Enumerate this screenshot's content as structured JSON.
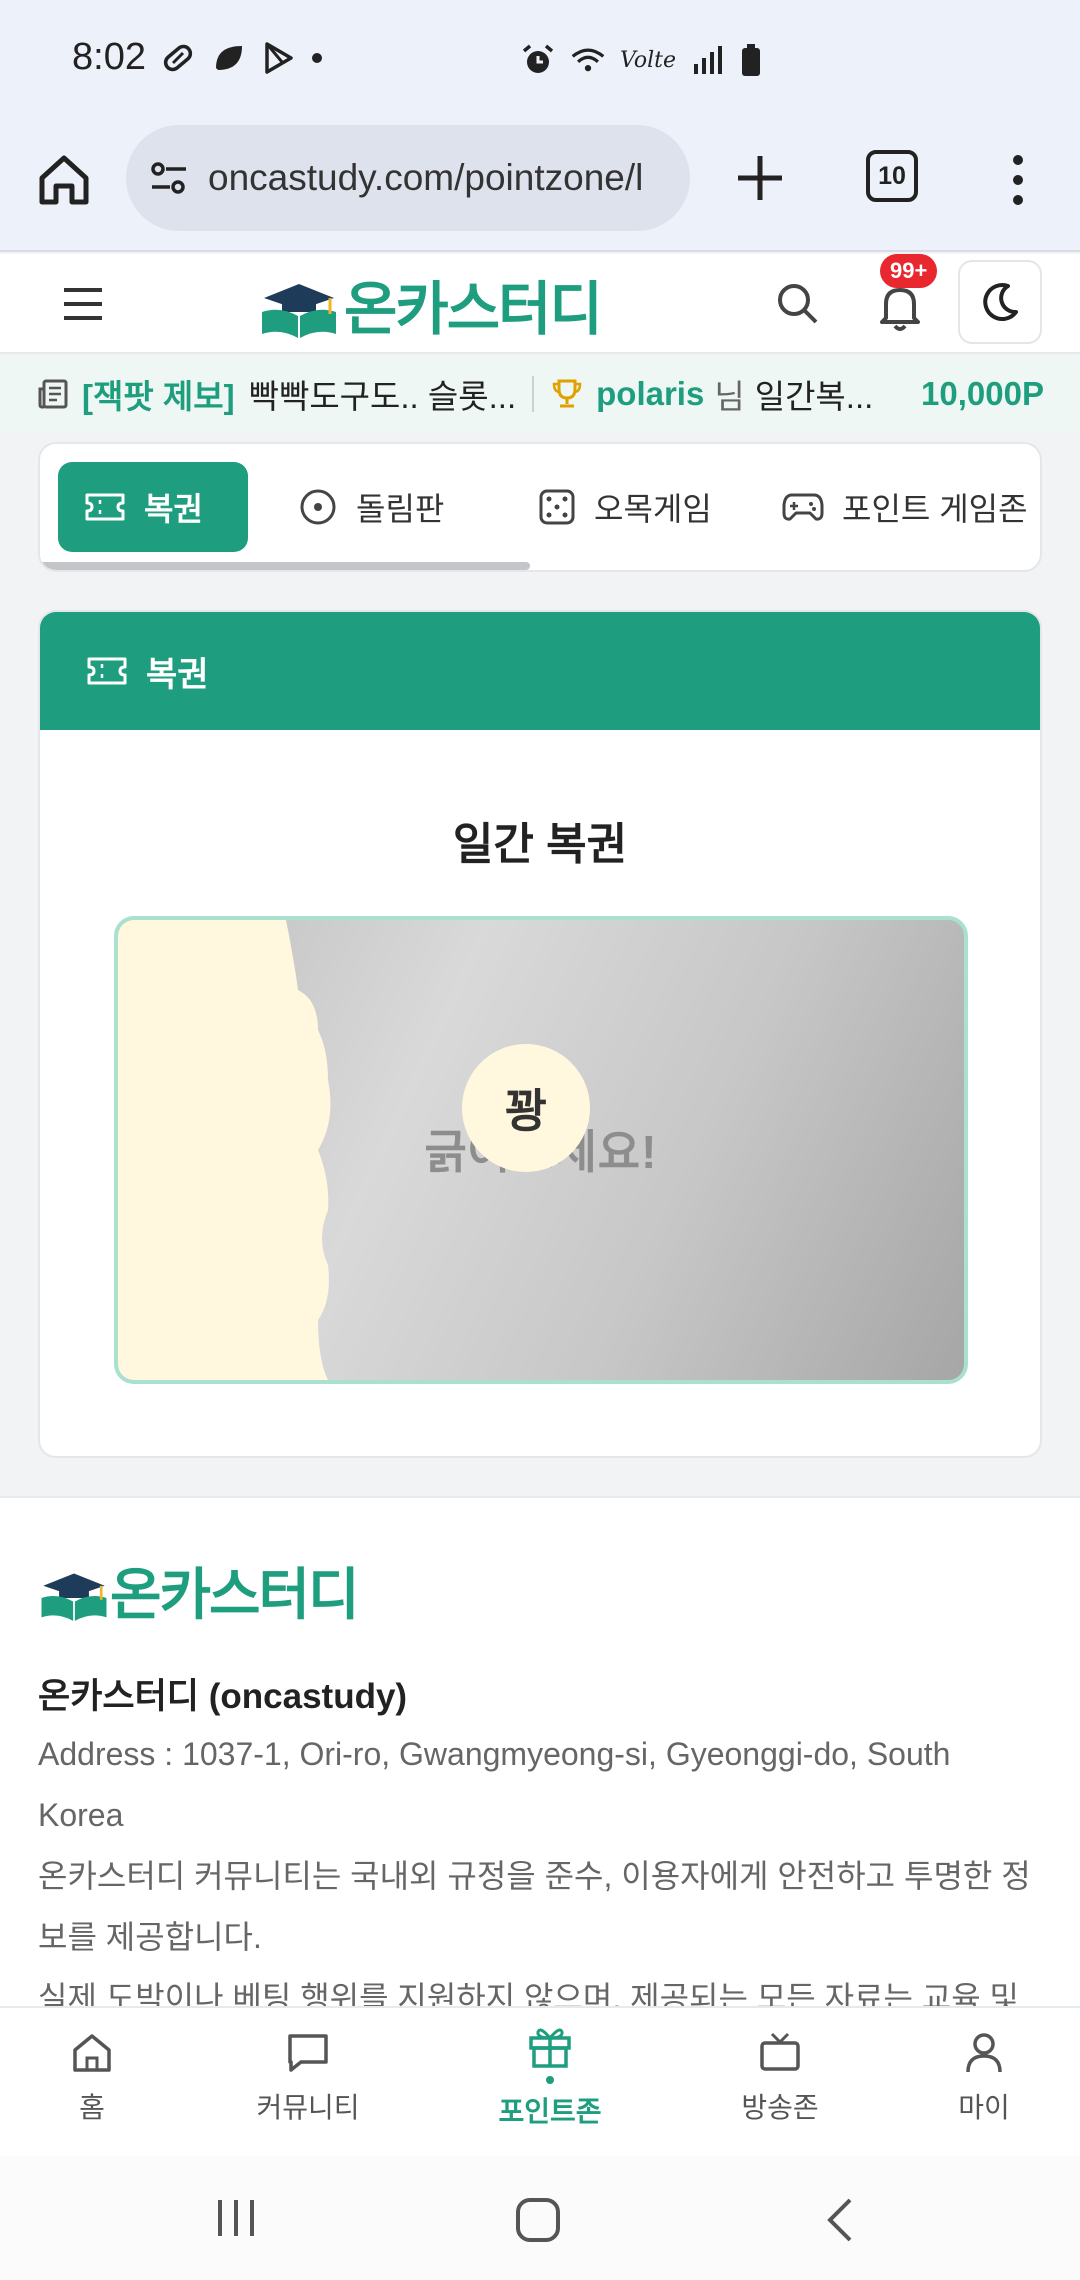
{
  "status_bar": {
    "time": "8:02",
    "left_icons": [
      "capsule-icon",
      "leaf-icon",
      "play-store-icon",
      "dot-icon"
    ],
    "right_icons": [
      "alarm-icon",
      "wifi-icon",
      "volte-icon",
      "signal-icon",
      "battery-icon"
    ],
    "volte_label": "Volte"
  },
  "browser": {
    "url": "oncastudy.com/pointzone/l",
    "tab_count": "10"
  },
  "site_header": {
    "logo_text": "온카스터디",
    "notification_badge": "99+"
  },
  "ticker": {
    "tag": "[잭팟 제보]",
    "text": "빡빡도구도.. 슬롯...",
    "user": "polaris",
    "nim": "님",
    "message": "일간복...",
    "points": "10,000P"
  },
  "tabs": [
    {
      "label": "복권",
      "icon": "ticket-icon",
      "active": true
    },
    {
      "label": "돌림판",
      "icon": "wheel-icon",
      "active": false
    },
    {
      "label": "오목게임",
      "icon": "dice-icon",
      "active": false
    },
    {
      "label": "포인트 게임존",
      "icon": "gamepad-icon",
      "active": false
    }
  ],
  "lottery": {
    "header": "복권",
    "title": "일간 복권",
    "scratch_hint": "긁어보세요!",
    "result": "꽝"
  },
  "footer": {
    "logo_text": "온카스터디",
    "company": "온카스터디 (oncastudy)",
    "address": "Address : 1037-1, Ori-ro, Gwangmyeong-si, Gyeonggi-do, South Korea",
    "desc1": "온카스터디 커뮤니티는 국내외 규정을 준수, 이용자에게 안전하고 투명한 정보를 제공합니다.",
    "desc2": "실제 도박이나 베팅 행위를 지원하지 않으며, 제공되는 모든 자료는 교육 및"
  },
  "bottom_nav": [
    {
      "label": "홈",
      "icon": "home-icon",
      "active": false
    },
    {
      "label": "커뮤니티",
      "icon": "chat-icon",
      "active": false
    },
    {
      "label": "포인트존",
      "icon": "gift-icon",
      "active": true
    },
    {
      "label": "방송존",
      "icon": "tv-icon",
      "active": false
    },
    {
      "label": "마이",
      "icon": "user-icon",
      "active": false
    }
  ],
  "colors": {
    "brand": "#1e9e7e",
    "badge": "#e8272f",
    "scratch_border": "#a9e0cf"
  }
}
